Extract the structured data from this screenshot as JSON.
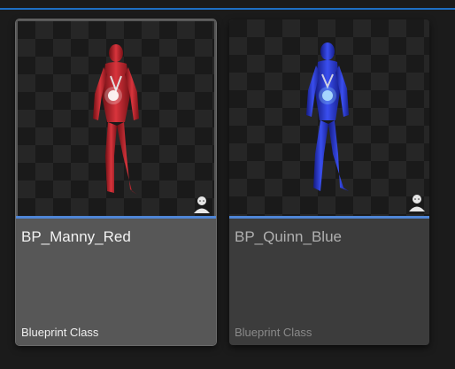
{
  "assets": [
    {
      "name": "BP_Manny_Red",
      "type": "Blueprint Class",
      "accent": "#4f86d6",
      "body_color": "#c22830"
    },
    {
      "name": "BP_Quinn_Blue",
      "type": "Blueprint Class",
      "accent": "#4f86d6",
      "body_color": "#2a3fd0"
    }
  ],
  "icons": {
    "thumbnail_overlay": "person-icon"
  }
}
